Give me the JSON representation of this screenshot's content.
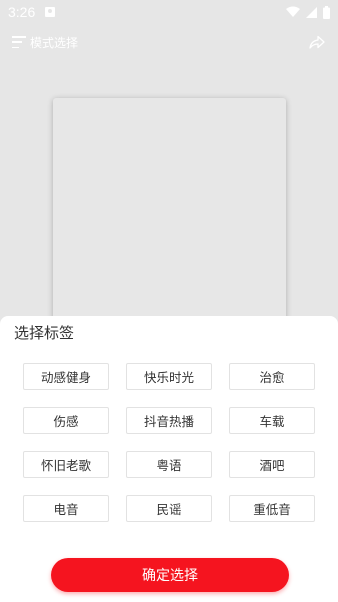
{
  "status_bar": {
    "time": "3:26",
    "icons": [
      "notification-icon",
      "wifi-icon",
      "signal-icon",
      "battery-icon"
    ]
  },
  "app_bar": {
    "title": "模式选择",
    "menu_icon": "menu-icon",
    "share_icon": "share-icon"
  },
  "sheet": {
    "title": "选择标签",
    "tags": [
      "动感健身",
      "快乐时光",
      "治愈",
      "伤感",
      "抖音热播",
      "车载",
      "怀旧老歌",
      "粤语",
      "酒吧",
      "电音",
      "民谣",
      "重低音"
    ],
    "confirm_label": "确定选择"
  },
  "colors": {
    "background": "#e6e6e6",
    "accent": "#f5141f",
    "sheet": "#ffffff",
    "tag_border": "#e2e2e2"
  }
}
